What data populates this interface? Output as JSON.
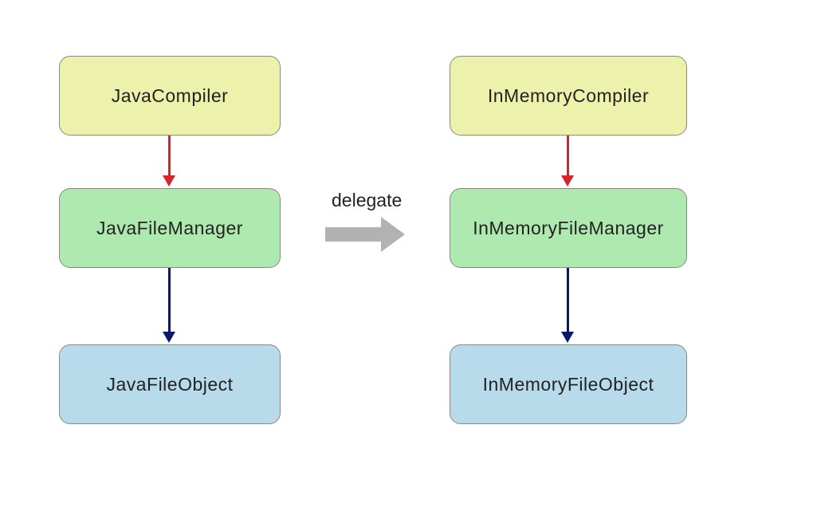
{
  "nodes": {
    "left_top": "JavaCompiler",
    "left_mid": "JavaFileManager",
    "left_bot": "JavaFileObject",
    "right_top": "InMemoryCompiler",
    "right_mid": "InMemoryFileManager",
    "right_bot": "InMemoryFileObject"
  },
  "labels": {
    "delegate": "delegate"
  },
  "colors": {
    "yellow": "#ecf2ab",
    "green": "#aee9af",
    "blue": "#b7dbeb",
    "arrow_red": "#d8232a",
    "arrow_navy": "#0a1a6a",
    "big_arrow": "#b2b2b2"
  }
}
